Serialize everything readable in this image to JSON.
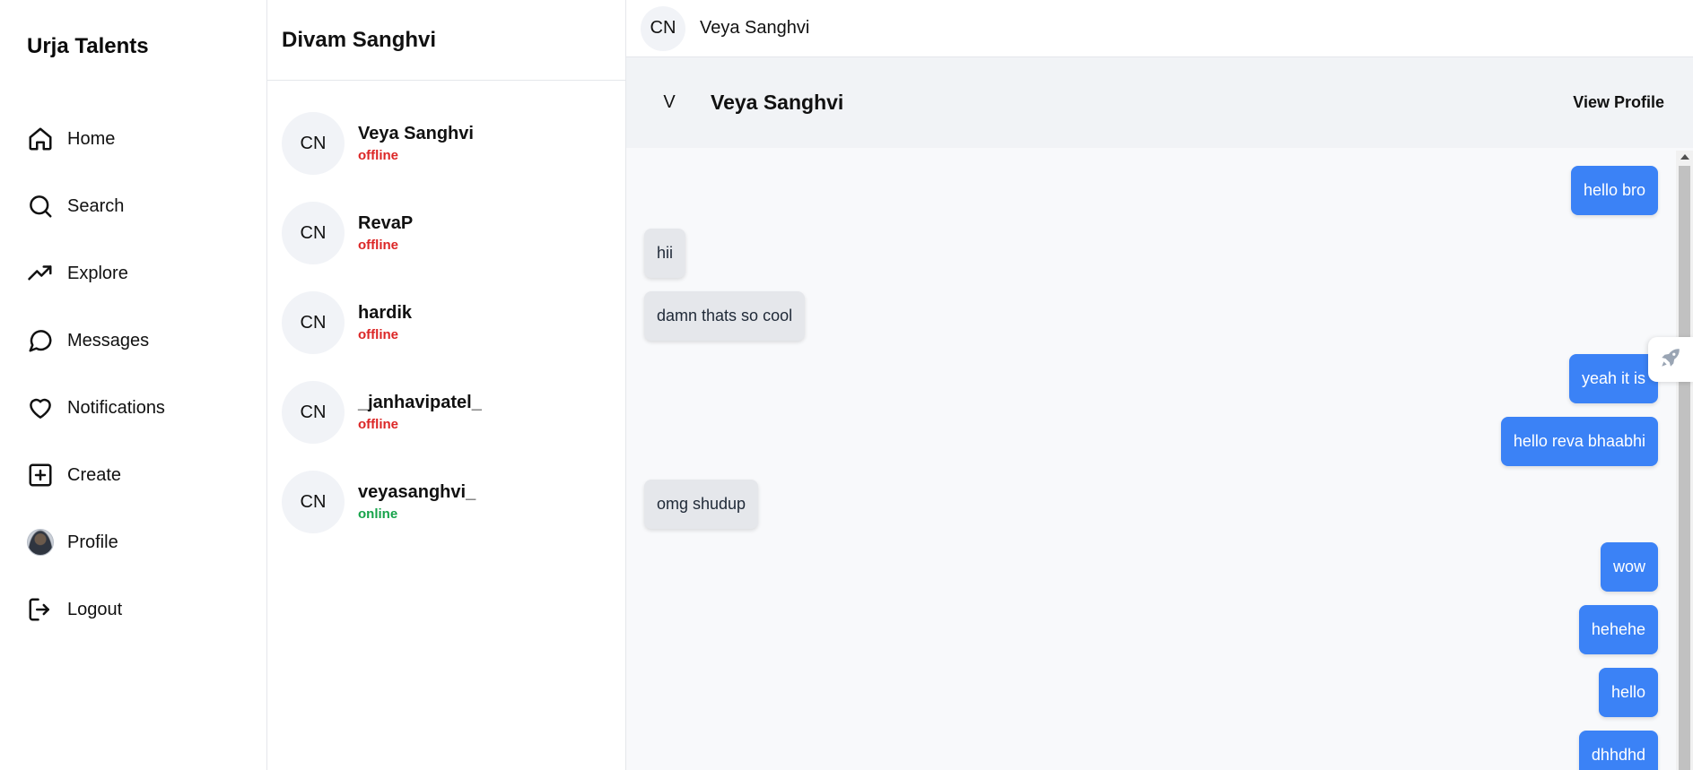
{
  "brand": "Urja Talents",
  "nav": {
    "items": [
      {
        "label": "Home",
        "icon": "home-icon"
      },
      {
        "label": "Search",
        "icon": "search-icon"
      },
      {
        "label": "Explore",
        "icon": "trending-up-icon"
      },
      {
        "label": "Messages",
        "icon": "message-circle-icon"
      },
      {
        "label": "Notifications",
        "icon": "heart-icon"
      },
      {
        "label": "Create",
        "icon": "plus-square-icon"
      },
      {
        "label": "Profile",
        "icon": "profile-avatar"
      },
      {
        "label": "Logout",
        "icon": "logout-icon"
      }
    ]
  },
  "list": {
    "title": "Divam Sanghvi",
    "conversations": [
      {
        "avatar": "CN",
        "name": "Veya Sanghvi",
        "status": "offline"
      },
      {
        "avatar": "CN",
        "name": "RevaP",
        "status": "offline"
      },
      {
        "avatar": "CN",
        "name": "hardik",
        "status": "offline"
      },
      {
        "avatar": "CN",
        "name": "_janhavipatel_",
        "status": "offline"
      },
      {
        "avatar": "CN",
        "name": "veyasanghvi_",
        "status": "online"
      }
    ]
  },
  "chat": {
    "topbar": {
      "avatar": "CN",
      "name": "Veya Sanghvi"
    },
    "header": {
      "avatar": "V",
      "name": "Veya Sanghvi",
      "view_profile_label": "View Profile"
    },
    "messages": [
      {
        "text": "hello bro",
        "direction": "out"
      },
      {
        "text": "hii",
        "direction": "in"
      },
      {
        "text": "damn thats so cool",
        "direction": "in"
      },
      {
        "text": "yeah it is",
        "direction": "out"
      },
      {
        "text": "hello reva bhaabhi",
        "direction": "out"
      },
      {
        "text": "omg shudup",
        "direction": "in"
      },
      {
        "text": "wow",
        "direction": "out"
      },
      {
        "text": "hehehe",
        "direction": "out"
      },
      {
        "text": "hello",
        "direction": "out"
      },
      {
        "text": "dhhdhd",
        "direction": "out"
      }
    ]
  },
  "colors": {
    "outgoing_bubble": "#3b82f6",
    "incoming_bubble": "#e5e7eb",
    "offline": "#dc2626",
    "online": "#16a34a"
  }
}
